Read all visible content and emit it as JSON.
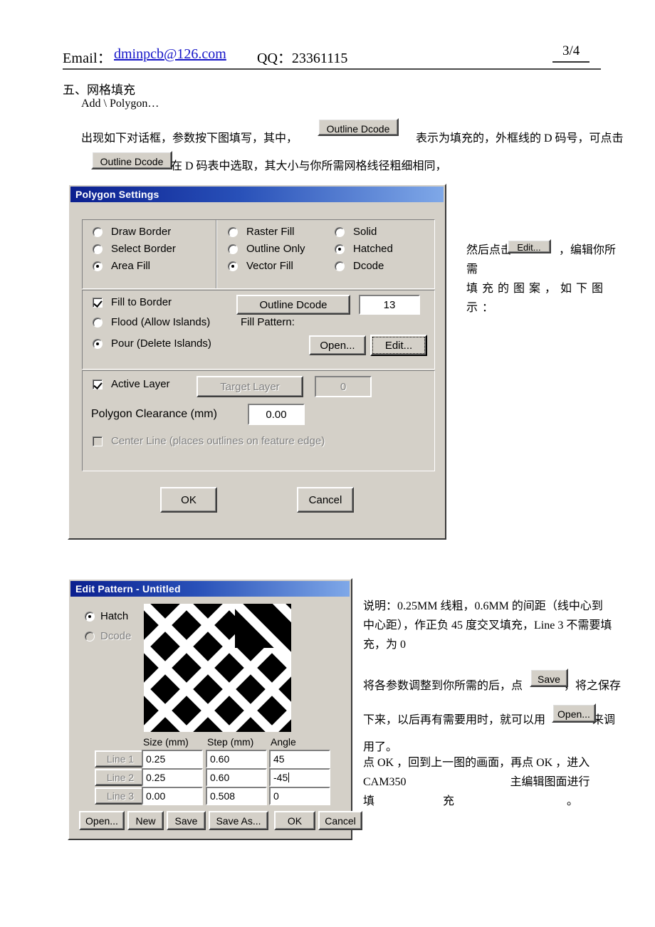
{
  "header": {
    "email_label": "Email：",
    "email": "dminpcb@126.com",
    "qq": "QQ：23361115",
    "page_number": "3/4"
  },
  "doc": {
    "section_title": "五、网格填充",
    "menu_path": "Add \\ Polygon…",
    "para1_a": "出现如下对话框，参数按下图填写，其中，",
    "para1_b": "表示为填充的，外框线的 D 码号，可点击",
    "para2": "在 D 码表中选取，其大小与你所需网格线径粗细相同，",
    "inline_btn_outline_dcode": "Outline Dcode"
  },
  "annotations": {
    "edit_line1_a": "然后点击",
    "edit_line1_b": "，编辑你所需",
    "edit_line2": "填充的图案，如下图示：",
    "edit_btn_label": "Edit...",
    "note_line1": "说明：0.25MM 线粗，0.6MM 的间距（线中心到",
    "note_line2": "中心距），作正负 45 度交叉填充，Line 3 不需要填",
    "note_line3": "充，为 0",
    "save_line1_a": "将各参数调整到你所需的后，点",
    "save_btn_label": "Save",
    "save_line1_b": "，将之保存",
    "save_line2_a": "下来，以后再有需要用时，就可以用",
    "open_btn_label": "Open...",
    "save_line2_b": "来调",
    "save_line3": "用了。",
    "ok_line1": "点 OK ，回到上一图的画面，再点 OK  ，进入",
    "ok_line2_a": "CAM350",
    "ok_line2_b": "主编辑图面进行",
    "ok_line3_a": "填",
    "ok_line3_b": "充",
    "ok_line3_c": "。"
  },
  "polygon_dialog": {
    "title": "Polygon Settings",
    "mode_options": [
      {
        "label": "Draw Border",
        "selected": false
      },
      {
        "label": "Select Border",
        "selected": false
      },
      {
        "label": "Area Fill",
        "selected": true
      }
    ],
    "fill_options": [
      {
        "label": "Raster Fill",
        "selected": false
      },
      {
        "label": "Outline Only",
        "selected": false
      },
      {
        "label": "Vector Fill",
        "selected": true
      }
    ],
    "style_options": [
      {
        "label": "Solid",
        "selected": false
      },
      {
        "label": "Hatched",
        "selected": true
      },
      {
        "label": "Dcode",
        "selected": false
      }
    ],
    "fill_to_border": {
      "label": "Fill to Border",
      "checked": true
    },
    "outline_dcode_button": "Outline Dcode",
    "outline_dcode_value": "13",
    "flood_option": {
      "label": "Flood (Allow Islands)",
      "selected": false
    },
    "fill_pattern_label": "Fill Pattern:",
    "pour_option": {
      "label": "Pour (Delete Islands)",
      "selected": true
    },
    "open_button": "Open...",
    "edit_button": "Edit...",
    "active_layer": {
      "label": "Active Layer",
      "checked": true
    },
    "target_layer_button": "Target Layer",
    "target_layer_value": "0",
    "clearance_label": "Polygon Clearance (mm)",
    "clearance_value": "0.00",
    "center_line": {
      "label": "Center Line  (places outlines on feature edge)",
      "checked": false
    },
    "ok_button": "OK",
    "cancel_button": "Cancel"
  },
  "pattern_dialog": {
    "title": "Edit Pattern - Untitled",
    "type_options": [
      {
        "label": "Hatch",
        "selected": true,
        "disabled": false
      },
      {
        "label": "Dcode",
        "selected": false,
        "disabled": true
      }
    ],
    "columns": [
      "Size (mm)",
      "Step (mm)",
      "Angle"
    ],
    "rows": [
      {
        "name": "Line 1",
        "size": "0.25",
        "step": "0.60",
        "angle": "45"
      },
      {
        "name": "Line 2",
        "size": "0.25",
        "step": "0.60",
        "angle": "-45"
      },
      {
        "name": "Line 3",
        "size": "0.00",
        "step": "0.508",
        "angle": "0"
      }
    ],
    "buttons": [
      "Open...",
      "New",
      "Save",
      "Save As...",
      "OK",
      "Cancel"
    ]
  },
  "colors": {
    "dialog_face": "#d4d0c8",
    "titlebar_start": "#0b1f8f",
    "titlebar_end": "#7fa8e8",
    "link": "#1515c8",
    "preview_bg": "#000000",
    "preview_line": "#ffffff"
  }
}
